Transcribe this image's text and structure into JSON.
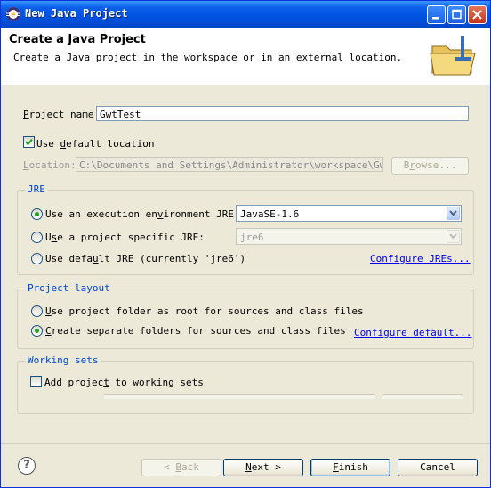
{
  "window": {
    "title": "New Java Project",
    "icon": "eclipse-icon"
  },
  "header": {
    "title": "Create a Java Project",
    "description": "Create a Java project in the workspace or in an external location.",
    "icon": "folder-icon"
  },
  "project_name": {
    "label_hot": "P",
    "label_rest": "roject name:",
    "value": "GwtTest"
  },
  "default_location": {
    "checked": true,
    "label_pre": "Use ",
    "label_hot": "d",
    "label_post": "efault location"
  },
  "location": {
    "label_hot": "L",
    "label_rest": "ocation:",
    "value": "C:\\Documents and Settings\\Administrator\\workspace\\GwtTest",
    "browse_pre": "B",
    "browse_hot": "r",
    "browse_post": "owse..."
  },
  "jre": {
    "group_label": "JRE",
    "option_exec": {
      "selected": true,
      "pre": "Use an execution en",
      "hot": "v",
      "post": "ironment JRE:",
      "combo_value": "JavaSE-1.6"
    },
    "option_specific": {
      "selected": false,
      "pre": "U",
      "hot": "s",
      "post": "e a project specific JRE:",
      "combo_value": "jre6"
    },
    "option_default": {
      "selected": false,
      "pre": "Use defa",
      "hot": "u",
      "post": "lt JRE (currently 'jre6')"
    },
    "configure_link": "Configure JREs..."
  },
  "project_layout": {
    "group_label": "Project layout",
    "option_root": {
      "selected": false,
      "pre": "",
      "hot": "U",
      "post": "se project folder as root for sources and class files"
    },
    "option_separate": {
      "selected": true,
      "pre": "",
      "hot": "C",
      "post": "reate separate folders for sources and class files"
    },
    "configure_link": "Configure default..."
  },
  "working_sets": {
    "group_label": "Working sets",
    "checked": false,
    "pre": "Add projec",
    "hot": "t",
    "post": " to working sets"
  },
  "footer": {
    "help_glyph": "?",
    "back_glyph": "<",
    "back_hot": "B",
    "back_post": "ack",
    "next_hot": "N",
    "next_post": "ext >",
    "finish_hot": "F",
    "finish_post": "inish",
    "cancel_label": "Cancel"
  }
}
